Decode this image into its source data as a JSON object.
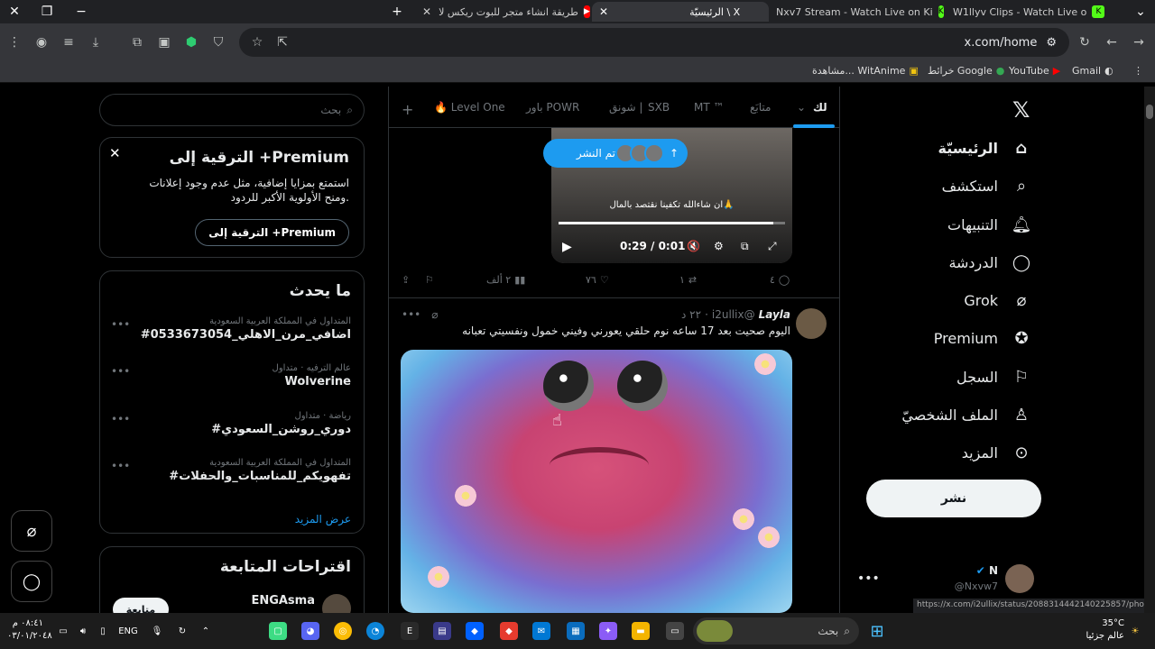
{
  "browser": {
    "tabs": [
      {
        "title": "طريقة انشاء متجر للبوت ريكس لا",
        "fav": "youtube-icon"
      },
      {
        "title": "الرئيسيّة \\ X",
        "fav": "x-icon"
      },
      {
        "title": "Nxv7 Stream - Watch Live on Ki",
        "fav": "kick-icon"
      },
      {
        "title": "W1llyv Clips - Watch Live o",
        "fav": "kick-icon"
      }
    ],
    "url": "x.com/home",
    "bookmarks": [
      "Gmail",
      "YouTube",
      "خرائط Google",
      "مشاهدة... WitAnime"
    ]
  },
  "sidebar_left": {
    "search_placeholder": "بحث",
    "premium": {
      "title": "الترقية إلى +Premium",
      "text": "استمتع بمزايا إضافية، مثل عدم وجود إعلانات ومنح الأولوية الأكبر للردود.",
      "button": "الترقية إلى +Premium"
    },
    "trends_title": "ما يحدث",
    "trends": [
      {
        "meta": "المتداول في المملكة العربية السعودية",
        "name": "#اضافي_مرن_الاهلي_0533673054"
      },
      {
        "meta": "عالم الترفيه · متداول",
        "name": "Wolverine"
      },
      {
        "meta": "رياضة · متداول",
        "name": "#دوري_روشن_السعودي"
      },
      {
        "meta": "المتداول في المملكة العربية السعودية",
        "name": "#تفهويكم_للمناسبات_والحفلات"
      }
    ],
    "show_more": "عرض المزيد",
    "follow_title": "اقتراحات المتابعة",
    "follow_name": "ENGAsma",
    "follow_button": "متابعة"
  },
  "feed": {
    "tabs": [
      "لك",
      "متابَع",
      "MT ™",
      "SXB",
      "شونق | POWR",
      "باور",
      "Level One"
    ],
    "posted_label": "تم النشر",
    "video": {
      "caption": "ان شاءالله تكفينا نقتصد بالمال🙏",
      "time": "0:29 / 0:01",
      "progress": 0.95
    },
    "actions": {
      "replies": "٤",
      "retweets": "١",
      "likes": "٧٦",
      "views": "٢ ألف"
    },
    "tweet": {
      "name": "Layla",
      "handle": "@i2ullix",
      "time": "٢٢ د",
      "text": "اليوم صحيت بعد 17 ساعه نوم حلقي يعورني وفيني خمول ونفسيتي تعبانه"
    }
  },
  "sidebar_right": {
    "nav": [
      "الرئيسيّة",
      "استكشف",
      "التنبيهات",
      "الدردشة",
      "Grok",
      "Premium",
      "السجل",
      "الملف الشخصيّ",
      "المزيد"
    ],
    "post_button": "نشر",
    "account": {
      "name": "N",
      "handle": "@Nxvw7"
    }
  },
  "status_url": "https://x.com/i2ullix/status/2088314442140225857/photo/1",
  "taskbar": {
    "search": "بحث",
    "lang": "ENG",
    "time": "٠٨:٤١ م",
    "date": "٠٣/٠١/٢٠٤٨",
    "weather_temp": "35°C",
    "weather_text": "عالم جزئيا"
  }
}
